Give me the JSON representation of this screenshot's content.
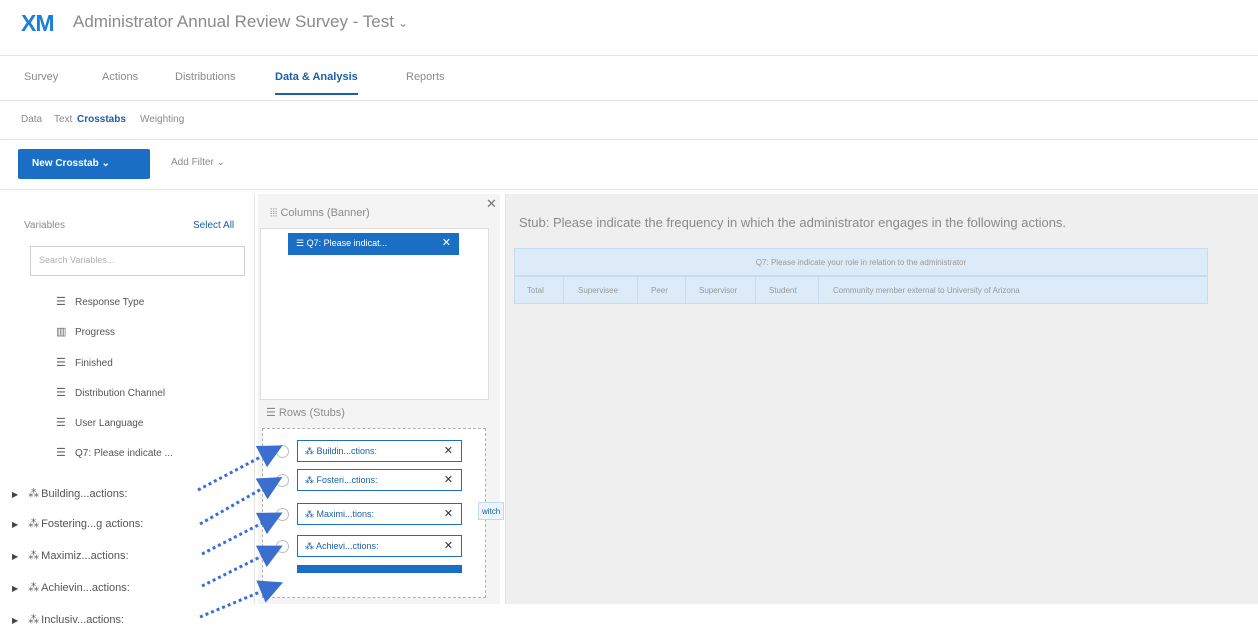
{
  "header": {
    "logo": "XM",
    "title": "Administrator Annual Review Survey - Test",
    "title_caret": "⌄"
  },
  "main_tabs": [
    {
      "label": "Survey"
    },
    {
      "label": "Actions"
    },
    {
      "label": "Distributions"
    },
    {
      "label": "Data & Analysis",
      "active": true
    },
    {
      "label": "Reports"
    }
  ],
  "sub_tabs": [
    {
      "label": "Data"
    },
    {
      "label": "Text"
    },
    {
      "label": "Crosstabs",
      "active": true
    },
    {
      "label": "Weighting"
    }
  ],
  "toolbar": {
    "new_crosstab_label": "New Crosstab ⌄",
    "add_filter_label": "Add Filter ⌄"
  },
  "variables": {
    "label": "Variables",
    "select_all": "Select All",
    "search_placeholder": "Search Variables...",
    "items": [
      {
        "label": "Response Type",
        "icon": "list-icon"
      },
      {
        "label": "Progress",
        "icon": "bar-chart-icon"
      },
      {
        "label": "Finished",
        "icon": "list-icon"
      },
      {
        "label": "Distribution Channel",
        "icon": "list-icon"
      },
      {
        "label": "User Language",
        "icon": "list-icon"
      },
      {
        "label": "Q7: Please indicate ...",
        "icon": "list-icon"
      }
    ],
    "groups": [
      {
        "label": "Building...actions:",
        "icon": "matrix-icon"
      },
      {
        "label": "Fostering...g actions:",
        "icon": "matrix-icon"
      },
      {
        "label": "Maximiz...actions:",
        "icon": "matrix-icon"
      },
      {
        "label": "Achievin...actions:",
        "icon": "matrix-icon"
      },
      {
        "label": "Inclusiv...actions:",
        "icon": "matrix-icon"
      }
    ]
  },
  "builder": {
    "columns_label": "Columns (Banner)",
    "column_chip": "Q7: Please indicat...",
    "rows_label": "Rows (Stubs)",
    "row_chips": [
      {
        "label": "Buildin...ctions:"
      },
      {
        "label": "Fosteri...ctions:"
      },
      {
        "label": "Maximi...tions:"
      },
      {
        "label": "Achievi...ctions:"
      }
    ],
    "side_tag": "witch"
  },
  "results": {
    "stub_title": "Stub: Please indicate the frequency in which the administrator engages in the following actions.",
    "banner_title": "Q7: Please indicate your role in relation to the administrator",
    "columns": [
      "Total",
      "Supervisee",
      "Peer",
      "Supervisor",
      "Student",
      "Community member external to University of Arizona"
    ]
  },
  "colors": {
    "accent": "#1a6fc4",
    "arrow": "#3a6fd0",
    "header_row": "#ddeaf7"
  }
}
